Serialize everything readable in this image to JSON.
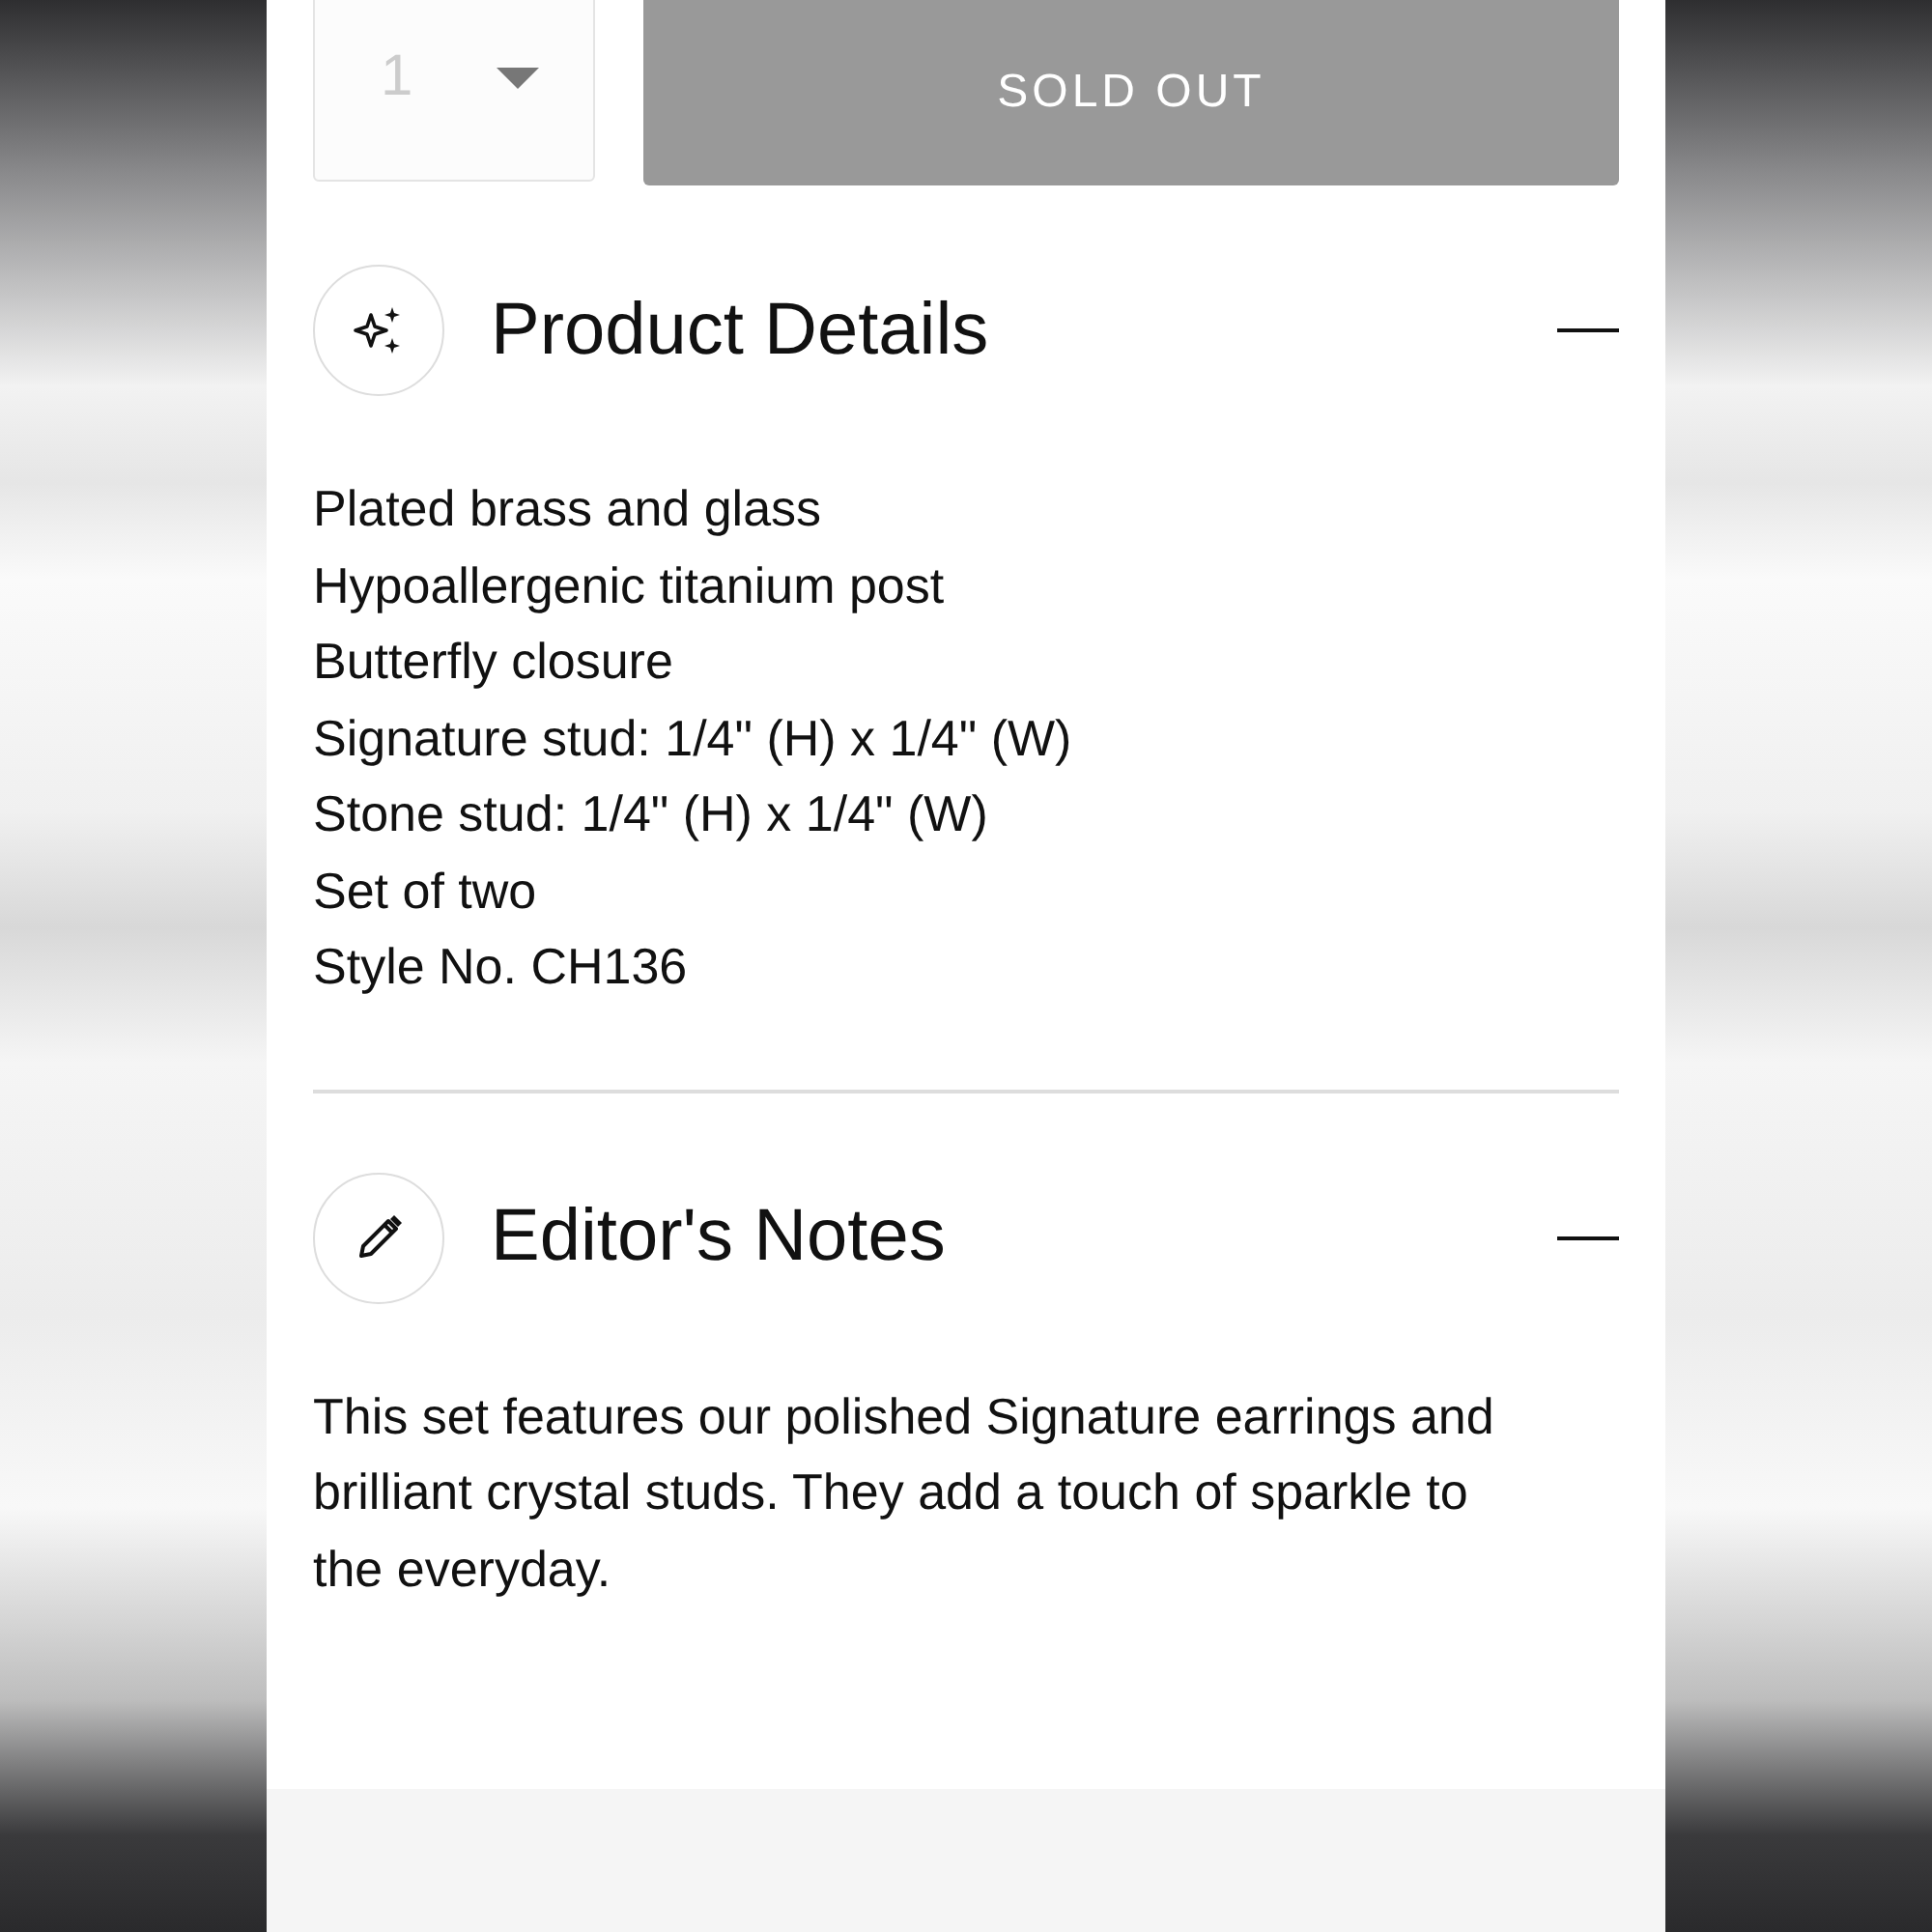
{
  "quantity": {
    "value": "1",
    "disabled": true
  },
  "add_button": {
    "label": "SOLD OUT",
    "disabled": true
  },
  "sections": [
    {
      "title": "Product Details",
      "expanded": true,
      "kind": "lines",
      "lines": [
        "Plated brass and glass",
        "Hypoallergenic titanium post",
        "Butterfly closure",
        "Signature stud: 1/4\" (H) x 1/4\" (W)",
        "Stone stud: 1/4\" (H) x 1/4\" (W)",
        "Set of two",
        "Style No. CH136"
      ]
    },
    {
      "title": "Editor's Notes",
      "expanded": true,
      "kind": "paragraph",
      "text": "This set features our polished Signature earrings and brilliant crystal studs. They add a touch of sparkle to the everyday."
    }
  ]
}
